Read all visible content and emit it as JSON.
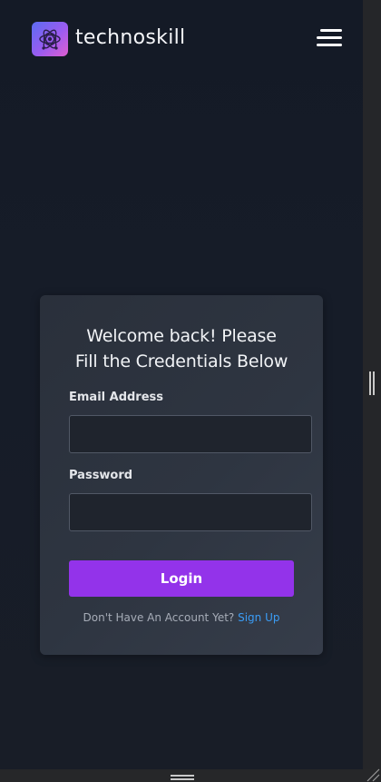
{
  "header": {
    "brand_name": "technoskill",
    "logo_icon": "atom-icon",
    "menu_icon": "hamburger-menu-icon"
  },
  "login_card": {
    "title_line1": "Welcome back! Please",
    "title_line2": "Fill the Credentials Below",
    "email_label": "Email Address",
    "email_value": "",
    "email_placeholder": "",
    "password_label": "Password",
    "password_value": "",
    "password_placeholder": "",
    "login_button_label": "Login",
    "signup_prompt": "Don't Have An Account Yet?",
    "signup_link_label": "Sign Up"
  },
  "colors": {
    "background": "#161c28",
    "card": "#2e3541",
    "primary_button": "#9333ea",
    "link": "#3b9cf5",
    "logo_gradient_start": "#5b6cf2",
    "logo_gradient_end": "#e05fd0"
  }
}
